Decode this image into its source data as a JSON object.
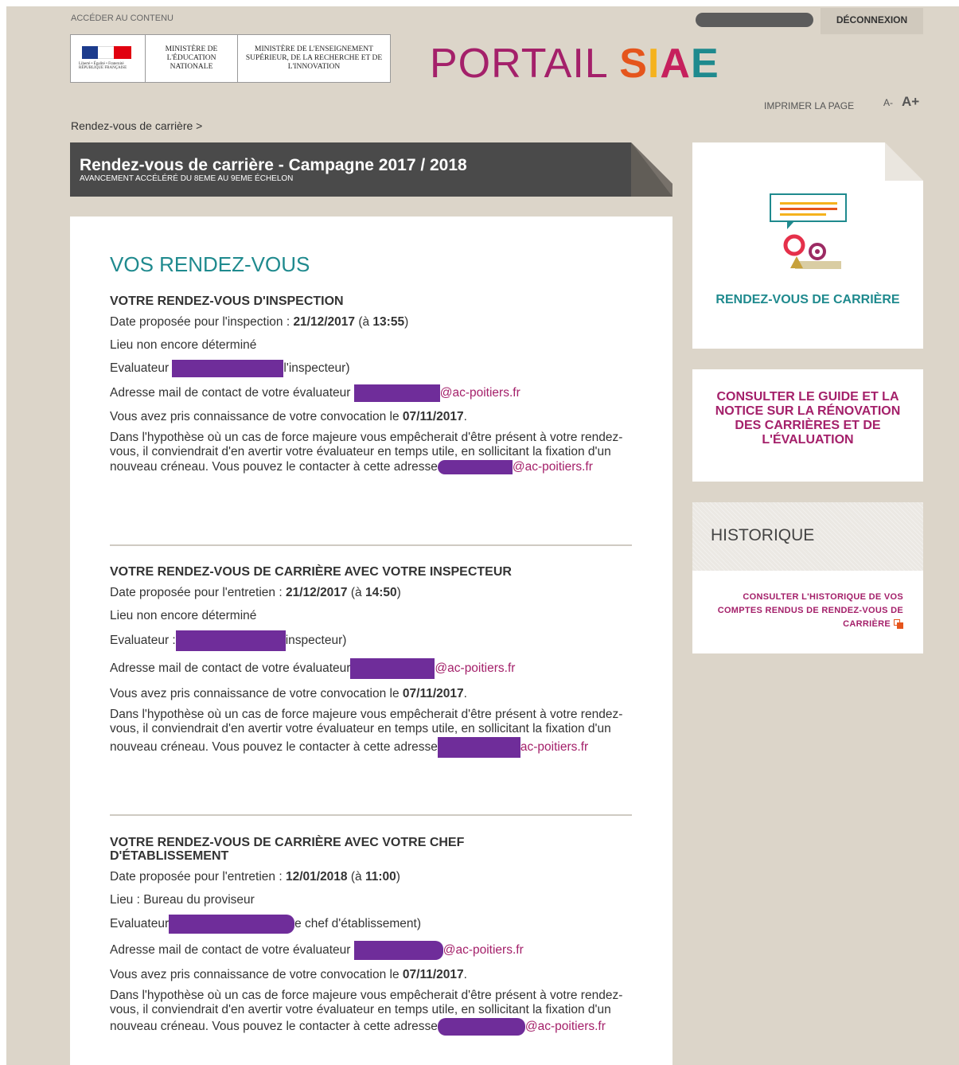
{
  "header": {
    "skip_link": "ACCÉDER AU CONTENU",
    "logout": "DÉCONNEXION",
    "ministry_flag_caption": "Liberté • Égalité • Fraternité RÉPUBLIQUE FRANÇAISE",
    "ministry_1": "MINISTÈRE DE L'ÉDUCATION NATIONALE",
    "ministry_2": "MINISTÈRE DE L'ENSEIGNEMENT SUPÉRIEUR, DE LA RECHERCHE ET DE L'INNOVATION",
    "portal_prefix": "PORTAIL",
    "portal_letters": [
      {
        "char": "S",
        "color": "#e5551c"
      },
      {
        "char": "I",
        "color": "#f5b21d"
      },
      {
        "char": "A",
        "color": "#c6205d"
      },
      {
        "char": "E",
        "color": "#1f8a8e"
      }
    ],
    "print": "IMPRIMER LA PAGE",
    "font_smaller": "A-",
    "font_larger": "A+"
  },
  "breadcrumb": "Rendez-vous de carrière >",
  "banner": {
    "title": "Rendez-vous de carrière - Campagne 2017 / 2018",
    "subtitle": "AVANCEMENT ACCÉLÉRÉ DU 8EME AU 9EME ÉCHELON"
  },
  "main": {
    "heading": "VOS RENDEZ-VOUS",
    "sections": [
      {
        "title": "VOTRE RENDEZ-VOUS D'INSPECTION",
        "date_label": "Date proposée pour l'inspection : ",
        "date": "21/12/2017",
        "time_pre": " (à ",
        "time": "13:55",
        "time_post": ")",
        "place": "Lieu non encore déterminé",
        "evaluator_label": "Evaluateur",
        "evaluator_role": "l'inspecteur)",
        "email_label": "Adresse mail de contact de votre évaluateur",
        "email_domain": "@ac-poitiers.fr",
        "convocation_label": "Vous avez pris connaissance de votre convocation le ",
        "convocation_date": "07/11/2017",
        "convocation_end": ".",
        "notice": "Dans l'hypothèse où un cas de force majeure vous empêcherait d'être présent à votre rendez-vous, il conviendrait d'en avertir votre évaluateur en temps utile, en sollicitant la fixation d'un nouveau créneau. Vous pouvez le contacter à cette adresse",
        "notice_domain": "@ac-poitiers.fr"
      },
      {
        "title": "VOTRE RENDEZ-VOUS DE CARRIÈRE AVEC VOTRE INSPECTEUR",
        "date_label": "Date proposée pour l'entretien : ",
        "date": "21/12/2017",
        "time_pre": " (à ",
        "time": "14:50",
        "time_post": ")",
        "place": "Lieu non encore déterminé",
        "evaluator_label": "Evaluateur :",
        "evaluator_role": "inspecteur)",
        "email_label": "Adresse mail de contact de votre évaluateur",
        "email_domain": "@ac-poitiers.fr",
        "convocation_label": "Vous avez pris connaissance de votre convocation le ",
        "convocation_date": "07/11/2017",
        "convocation_end": ".",
        "notice": "Dans l'hypothèse où un cas de force majeure vous empêcherait d'être présent à votre rendez-vous, il conviendrait d'en avertir votre évaluateur en temps utile, en sollicitant la fixation d'un nouveau créneau. Vous pouvez le contacter à cette adresse",
        "notice_domain": "ac-poitiers.fr"
      },
      {
        "title": "VOTRE RENDEZ-VOUS DE CARRIÈRE AVEC VOTRE CHEF D'ÉTABLISSEMENT",
        "date_label": "Date proposée pour l'entretien : ",
        "date": "12/01/2018",
        "time_pre": " (à ",
        "time": "11:00",
        "time_post": ")",
        "place": "Lieu : Bureau du proviseur",
        "evaluator_label": "Evaluateur",
        "evaluator_role": "e chef d'établissement)",
        "email_label": "Adresse mail de contact de votre évaluateur",
        "email_domain": "@ac-poitiers.fr",
        "convocation_label": "Vous avez pris connaissance de votre convocation le ",
        "convocation_date": "07/11/2017",
        "convocation_end": ".",
        "notice": "Dans l'hypothèse où un cas de force majeure vous empêcherait d'être présent à votre rendez-vous, il conviendrait d'en avertir votre évaluateur en temps utile, en sollicitant la fixation d'un nouveau créneau. Vous pouvez le contacter à cette adresse",
        "notice_domain": "@ac-poitiers.fr"
      }
    ]
  },
  "sidebar": {
    "card1_label": "RENDEZ-VOUS DE CARRIÈRE",
    "card2_label": "CONSULTER LE GUIDE ET LA NOTICE SUR LA RÉNOVATION DES CARRIÈRES ET DE L'ÉVALUATION",
    "history_title": "HISTORIQUE",
    "history_link": "CONSULTER L'HISTORIQUE DE VOS COMPTES RENDUS DE RENDEZ-VOUS DE CARRIÈRE",
    "history_icon": "external-link-icon"
  },
  "colors": {
    "background": "#dcd5c9",
    "teal": "#1f8a8e",
    "magenta": "#a4206a",
    "redaction": "#6f2d9a",
    "banner": "#4a4a4a"
  }
}
